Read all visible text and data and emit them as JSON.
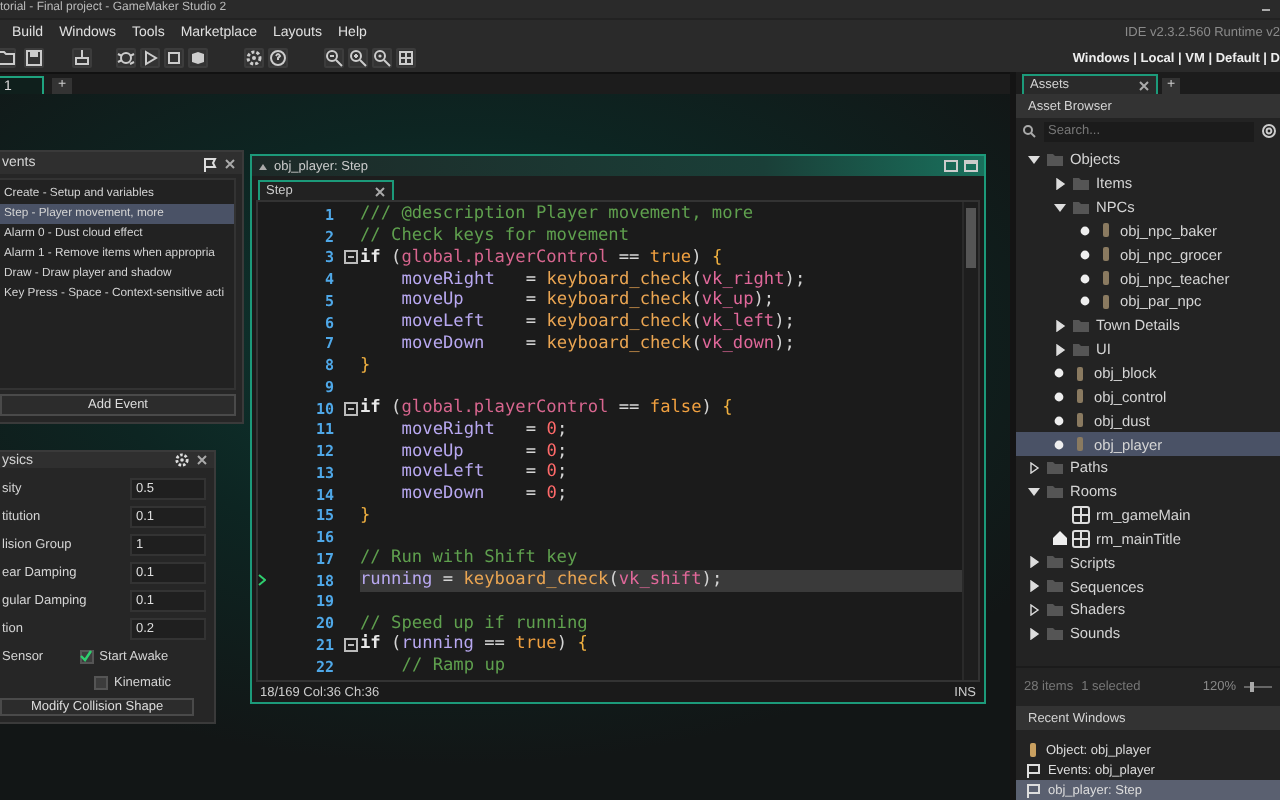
{
  "title_bar": {
    "title": "torial - Final project - GameMaker Studio 2"
  },
  "menu": [
    "Build",
    "Windows",
    "Tools",
    "Marketplace",
    "Layouts",
    "Help"
  ],
  "version": "IDE v2.3.2.560  Runtime v2",
  "target_bar": "Windows | Local | VM | Default | D",
  "workspace_tabs": [
    {
      "label": "1",
      "selected": true
    }
  ],
  "workspace_add": "+",
  "events_panel": {
    "title": "vents",
    "items": [
      {
        "label": "Create - Setup and variables",
        "selected": false
      },
      {
        "label": "Step - Player movement, more",
        "selected": true
      },
      {
        "label": "Alarm 0 - Dust cloud effect",
        "selected": false
      },
      {
        "label": "Alarm 1 - Remove items when appropria",
        "selected": false
      },
      {
        "label": "Draw - Draw player and shadow",
        "selected": false
      },
      {
        "label": "Key Press - Space - Context-sensitive acti",
        "selected": false
      }
    ],
    "add_button": "Add Event"
  },
  "physics_panel": {
    "title": "ysics",
    "fields": [
      {
        "label": "sity",
        "value": "0.5"
      },
      {
        "label": "titution",
        "value": "0.1"
      },
      {
        "label": "lision Group",
        "value": "1"
      },
      {
        "label": "ear Damping",
        "value": "0.1"
      },
      {
        "label": "gular Damping",
        "value": "0.1"
      },
      {
        "label": "tion",
        "value": "0.2"
      }
    ],
    "sensor_label": "Sensor",
    "checkboxes": [
      {
        "label": "Start Awake",
        "checked": true
      },
      {
        "label": "Kinematic",
        "checked": false
      }
    ],
    "shape_button": "Modify Collision Shape"
  },
  "code_window": {
    "title": "obj_player: Step",
    "tab": "Step",
    "lines": [
      {
        "number": "1",
        "fold": false,
        "selected": false,
        "indented": false,
        "tokens": [
          {
            "kind": "comment",
            "text": "/// @description Player movement, more"
          }
        ]
      },
      {
        "number": "2",
        "fold": false,
        "selected": false,
        "indented": false,
        "tokens": [
          {
            "kind": "comment",
            "text": "// Check keys for movement"
          }
        ]
      },
      {
        "number": "3",
        "fold": true,
        "selected": false,
        "indented": false,
        "tokens": [
          {
            "kind": "keyword",
            "text": "if"
          },
          {
            "kind": "plain",
            "text": " ("
          },
          {
            "kind": "global",
            "text": "global.playerControl"
          },
          {
            "kind": "plain",
            "text": " == "
          },
          {
            "kind": "bool",
            "text": "true"
          },
          {
            "kind": "plain",
            "text": ") "
          },
          {
            "kind": "brace",
            "text": "{"
          }
        ]
      },
      {
        "number": "4",
        "fold": false,
        "selected": false,
        "indented": true,
        "tokens": [
          {
            "kind": "var",
            "text": "moveRight"
          },
          {
            "kind": "plain",
            "text": "   = "
          },
          {
            "kind": "func",
            "text": "keyboard_check"
          },
          {
            "kind": "plain",
            "text": "("
          },
          {
            "kind": "const",
            "text": "vk_right"
          },
          {
            "kind": "plain",
            "text": ");"
          }
        ]
      },
      {
        "number": "5",
        "fold": false,
        "selected": false,
        "indented": true,
        "tokens": [
          {
            "kind": "var",
            "text": "moveUp"
          },
          {
            "kind": "plain",
            "text": "      = "
          },
          {
            "kind": "func",
            "text": "keyboard_check"
          },
          {
            "kind": "plain",
            "text": "("
          },
          {
            "kind": "const",
            "text": "vk_up"
          },
          {
            "kind": "plain",
            "text": ");"
          }
        ]
      },
      {
        "number": "6",
        "fold": false,
        "selected": false,
        "indented": true,
        "tokens": [
          {
            "kind": "var",
            "text": "moveLeft"
          },
          {
            "kind": "plain",
            "text": "    = "
          },
          {
            "kind": "func",
            "text": "keyboard_check"
          },
          {
            "kind": "plain",
            "text": "("
          },
          {
            "kind": "const",
            "text": "vk_left"
          },
          {
            "kind": "plain",
            "text": ");"
          }
        ]
      },
      {
        "number": "7",
        "fold": false,
        "selected": false,
        "indented": true,
        "tokens": [
          {
            "kind": "var",
            "text": "moveDown"
          },
          {
            "kind": "plain",
            "text": "    = "
          },
          {
            "kind": "func",
            "text": "keyboard_check"
          },
          {
            "kind": "plain",
            "text": "("
          },
          {
            "kind": "const",
            "text": "vk_down"
          },
          {
            "kind": "plain",
            "text": ");"
          }
        ]
      },
      {
        "number": "8",
        "fold": false,
        "selected": false,
        "indented": false,
        "tokens": [
          {
            "kind": "brace",
            "text": "}"
          }
        ]
      },
      {
        "number": "9",
        "fold": false,
        "selected": false
      },
      {
        "number": "10",
        "fold": true,
        "selected": false,
        "indented": false,
        "tokens": [
          {
            "kind": "keyword",
            "text": "if"
          },
          {
            "kind": "plain",
            "text": " ("
          },
          {
            "kind": "global",
            "text": "global.playerControl"
          },
          {
            "kind": "plain",
            "text": " == "
          },
          {
            "kind": "bool",
            "text": "false"
          },
          {
            "kind": "plain",
            "text": ") "
          },
          {
            "kind": "brace",
            "text": "{"
          }
        ]
      },
      {
        "number": "11",
        "fold": false,
        "selected": false,
        "indented": true,
        "tokens": [
          {
            "kind": "var",
            "text": "moveRight"
          },
          {
            "kind": "plain",
            "text": "   = "
          },
          {
            "kind": "number",
            "text": "0"
          },
          {
            "kind": "plain",
            "text": ";"
          }
        ]
      },
      {
        "number": "12",
        "fold": false,
        "selected": false,
        "indented": true,
        "tokens": [
          {
            "kind": "var",
            "text": "moveUp"
          },
          {
            "kind": "plain",
            "text": "      = "
          },
          {
            "kind": "number",
            "text": "0"
          },
          {
            "kind": "plain",
            "text": ";"
          }
        ]
      },
      {
        "number": "13",
        "fold": false,
        "selected": false,
        "indented": true,
        "tokens": [
          {
            "kind": "var",
            "text": "moveLeft"
          },
          {
            "kind": "plain",
            "text": "    = "
          },
          {
            "kind": "number",
            "text": "0"
          },
          {
            "kind": "plain",
            "text": ";"
          }
        ]
      },
      {
        "number": "14",
        "fold": false,
        "selected": false,
        "indented": true,
        "tokens": [
          {
            "kind": "var",
            "text": "moveDown"
          },
          {
            "kind": "plain",
            "text": "    = "
          },
          {
            "kind": "number",
            "text": "0"
          },
          {
            "kind": "plain",
            "text": ";"
          }
        ]
      },
      {
        "number": "15",
        "fold": false,
        "selected": false,
        "indented": false,
        "tokens": [
          {
            "kind": "brace",
            "text": "}"
          }
        ]
      },
      {
        "number": "16",
        "fold": false,
        "selected": false
      },
      {
        "number": "17",
        "fold": false,
        "selected": false,
        "indented": false,
        "tokens": [
          {
            "kind": "comment",
            "text": "// Run with Shift key"
          }
        ]
      },
      {
        "number": "18",
        "fold": false,
        "selected": true,
        "indented": false,
        "tokens": [
          {
            "kind": "var",
            "text": "running"
          },
          {
            "kind": "plain",
            "text": " = "
          },
          {
            "kind": "func",
            "text": "keyboard_check"
          },
          {
            "kind": "plain",
            "text": "("
          },
          {
            "kind": "const",
            "text": "vk_shift"
          },
          {
            "kind": "plain",
            "text": ");"
          }
        ]
      },
      {
        "number": "19",
        "fold": false,
        "selected": false
      },
      {
        "number": "20",
        "fold": false,
        "selected": false,
        "indented": false,
        "tokens": [
          {
            "kind": "comment",
            "text": "// Speed up if running"
          }
        ]
      },
      {
        "number": "21",
        "fold": true,
        "selected": false,
        "indented": false,
        "tokens": [
          {
            "kind": "keyword",
            "text": "if"
          },
          {
            "kind": "plain",
            "text": " ("
          },
          {
            "kind": "var",
            "text": "running"
          },
          {
            "kind": "plain",
            "text": " == "
          },
          {
            "kind": "bool",
            "text": "true"
          },
          {
            "kind": "plain",
            "text": ") "
          },
          {
            "kind": "brace",
            "text": "{"
          }
        ]
      },
      {
        "number": "22",
        "fold": false,
        "selected": false,
        "indented": true,
        "tokens": [
          {
            "kind": "comment",
            "text": "// Ramp up"
          }
        ]
      }
    ],
    "status": "18/169 Col:36 Ch:36",
    "mode": "INS"
  },
  "assets": {
    "tab": "Assets",
    "add": "+",
    "header": "Asset Browser",
    "search_placeholder": "Search...",
    "tree": [
      {
        "label": "Objects",
        "kind": "folder",
        "expanded": true,
        "selected": false,
        "children": [
          {
            "label": "Items",
            "kind": "folder",
            "empty": false,
            "expanded": false,
            "selected": false
          },
          {
            "label": "NPCs",
            "kind": "folder",
            "expanded": true,
            "selected": false,
            "children": [
              {
                "label": "obj_npc_baker",
                "kind": "object",
                "selected": false
              },
              {
                "label": "obj_npc_grocer",
                "kind": "object",
                "selected": false
              },
              {
                "label": "obj_npc_teacher",
                "kind": "object",
                "selected": false
              },
              {
                "label": "obj_par_npc",
                "kind": "object",
                "selected": false
              }
            ]
          },
          {
            "label": "Town Details",
            "kind": "folder",
            "empty": false,
            "expanded": false,
            "selected": false
          },
          {
            "label": "UI",
            "kind": "folder",
            "empty": false,
            "expanded": false,
            "selected": false
          },
          {
            "label": "obj_block",
            "kind": "object",
            "selected": false
          },
          {
            "label": "obj_control",
            "kind": "object",
            "selected": false
          },
          {
            "label": "obj_dust",
            "kind": "object",
            "selected": false
          },
          {
            "label": "obj_player",
            "kind": "object",
            "selected": true
          }
        ]
      },
      {
        "label": "Paths",
        "kind": "folder",
        "empty": true,
        "expanded": false,
        "selected": false
      },
      {
        "label": "Rooms",
        "kind": "folder",
        "expanded": true,
        "selected": false,
        "children": [
          {
            "label": "rm_gameMain",
            "kind": "room",
            "home": false,
            "selected": false
          },
          {
            "label": "rm_mainTitle",
            "kind": "room",
            "home": true,
            "selected": false
          }
        ]
      },
      {
        "label": "Scripts",
        "kind": "folder",
        "empty": false,
        "expanded": false,
        "selected": false
      },
      {
        "label": "Sequences",
        "kind": "folder",
        "empty": false,
        "expanded": false,
        "selected": false
      },
      {
        "label": "Shaders",
        "kind": "folder",
        "empty": true,
        "expanded": false,
        "selected": false
      },
      {
        "label": "Sounds",
        "kind": "folder",
        "empty": false,
        "expanded": false,
        "selected": false
      }
    ],
    "item_count": "28 items",
    "selected_count": "1 selected",
    "zoom": "120%",
    "zoom_slider": {
      "level": 0.25
    }
  },
  "recent_windows": {
    "header": "Recent Windows",
    "items": [
      {
        "label": "Object: obj_player",
        "kind": "object",
        "selected": false
      },
      {
        "label": "Events: obj_player",
        "kind": "events",
        "selected": false
      },
      {
        "label": "obj_player: Step",
        "kind": "events",
        "selected": true
      }
    ]
  }
}
